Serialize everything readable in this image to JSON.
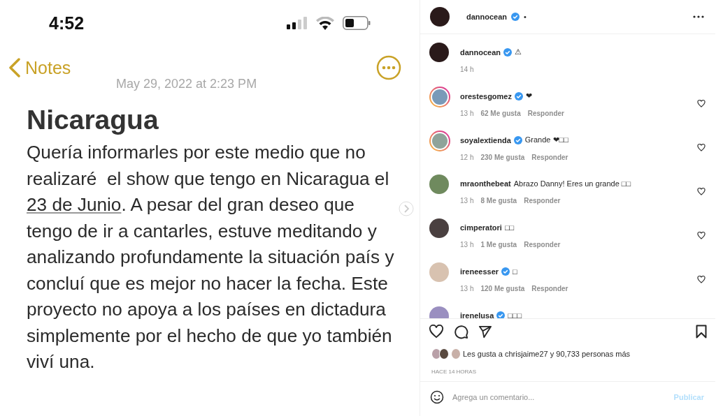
{
  "note": {
    "status_time": "4:52",
    "back_label": "Notes",
    "date": "May 29, 2022 at 2:23 PM",
    "title": "Nicaragua",
    "body": [
      {
        "kind": "plain",
        "text": "Quería informarles por este medio que no realizaré  el show que tengo en Nicaragua el "
      },
      {
        "kind": "date_link",
        "text": "23 de Junio"
      },
      {
        "kind": "plain",
        "text": ". A pesar del gran deseo que tengo de ir a cantarles, estuve meditando y analizando profundamente la situación país y concluí que es mejor no hacer la fecha. Este proyecto no apoya a los países en dictadura simplemente por el hecho de que yo también viví una."
      }
    ]
  },
  "post": {
    "author": {
      "username": "dannocean",
      "verified": true,
      "separator": "•"
    },
    "caption": {
      "username": "dannocean",
      "verified": true,
      "text": "⚠",
      "time": "14 h"
    },
    "comments": [
      {
        "username": "orestesgomez",
        "verified": true,
        "story_ring": true,
        "text": "❤",
        "time": "13 h",
        "likes": "62 Me gusta",
        "reply": "Responder",
        "color": "#7a9ab8"
      },
      {
        "username": "soyalextienda",
        "verified": true,
        "story_ring": true,
        "text": "Grande ❤□□",
        "time": "12 h",
        "likes": "230 Me gusta",
        "reply": "Responder",
        "color": "#8fa39a"
      },
      {
        "username": "mraonthebeat",
        "verified": false,
        "story_ring": false,
        "text": "Abrazo Danny! Eres un grande □□",
        "time": "13 h",
        "likes": "8 Me gusta",
        "reply": "Responder",
        "color": "#6f8a5e"
      },
      {
        "username": "cimperatori",
        "verified": false,
        "story_ring": false,
        "text": "□□",
        "time": "13 h",
        "likes": "1 Me gusta",
        "reply": "Responder",
        "color": "#4a4040"
      },
      {
        "username": "ireneesser",
        "verified": true,
        "story_ring": false,
        "text": "□",
        "time": "13 h",
        "likes": "120 Me gusta",
        "reply": "Responder",
        "color": "#d8c2b0"
      },
      {
        "username": "irenelusa",
        "verified": true,
        "story_ring": false,
        "text": "□□□",
        "color": "#9a8fc0"
      }
    ],
    "likes_text": "Les gusta a chrisjaime27 y 90,733 personas más",
    "posted": "HACE 14 HORAS",
    "comment_input": {
      "placeholder": "Agrega un comentario...",
      "submit": "Publicar"
    }
  }
}
